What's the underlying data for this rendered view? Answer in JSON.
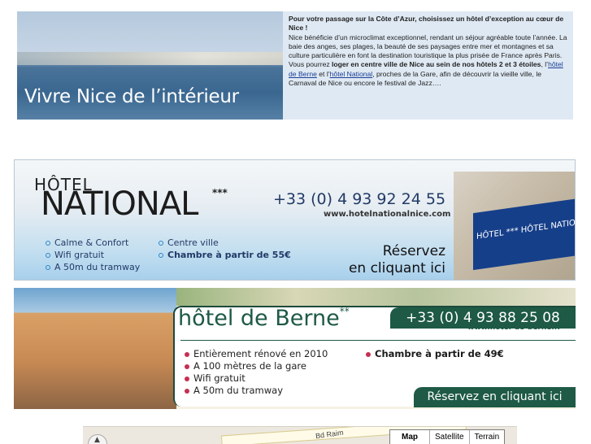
{
  "intro_banner": {
    "tagline": "Vivre Nice de l’intérieur",
    "headline": "Pour votre passage sur la Côte d’Azur, choisissez un hôtel d’exception au cœur de Nice !",
    "paragraph_part1": "Nice bénéficie d’un microclimat exceptionnel, rendant un séjour agréable toute l’année. La baie des anges, ses plages, la beauté de ses paysages entre mer et montagnes et sa culture particulière en font la destination touristique la plus prisée de France après Paris. Vous pourrez ",
    "paragraph_bold": "loger en centre ville de Nice au sein de nos hôtels 2 et 3 étoiles",
    "paragraph_part2": ", l’",
    "link_berne": "hôtel de Berne",
    "paragraph_part3": " et l’",
    "link_national": "hôtel National",
    "paragraph_part4": ", proches de la Gare, afin de découvrir la vieille ville, le Carnaval de Nice ou encore le festival de Jazz…."
  },
  "national_banner": {
    "hotel_word": "HÔTEL",
    "brand": "NATIONAL",
    "stars": "***",
    "phone": "+33 (0) 4 93 92 24 55",
    "website": "www.hotelnationalnice.com",
    "features_left": [
      "Calme & Confort",
      "Wifi gratuit",
      "A 50m  du tramway"
    ],
    "features_right": [
      "Centre ville",
      "Chambre à partir de 55€"
    ],
    "cta_line1": "Réservez",
    "cta_line2": "en cliquant ici",
    "awning_text": "HÔTEL ***  HÔTEL NATIONAL ***",
    "colors": {
      "accent": "#2a86c7",
      "awning": "#163f8a",
      "text": "#223a67"
    }
  },
  "berne_banner": {
    "title": "hôtel de Berne",
    "stars": "**",
    "phone": "+33 (0) 4 93 88 25 08",
    "website": "www.hotel-de-berne.fr",
    "features_left": [
      "Entièrement rénové en 2010",
      "A 100 mètres de la gare",
      "Wifi gratuit",
      "A 50m du tramway"
    ],
    "price": "Chambre à partir de 49€",
    "cta": "Réservez en cliquant ici",
    "colors": {
      "brand": "#1e5a45",
      "bullet": "#c62f53"
    }
  },
  "map": {
    "street_label": "Bd Raim",
    "types": [
      "Map",
      "Satellite",
      "Terrain"
    ],
    "active_type": "Map",
    "pan_icon": "pan-control-icon"
  }
}
